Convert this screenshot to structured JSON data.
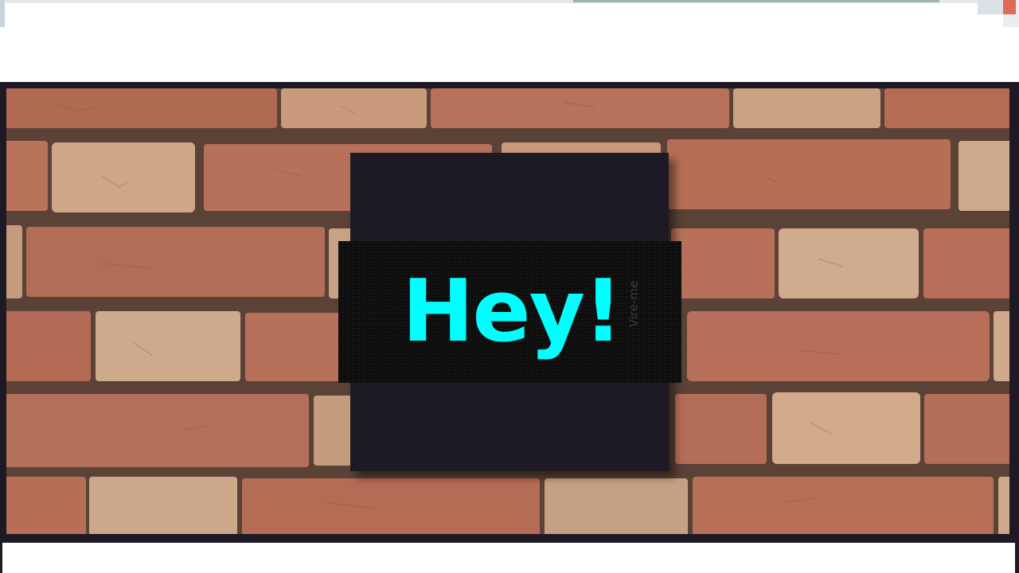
{
  "hero": {
    "heading": "Hey!",
    "vertical_label": "Vire-me"
  },
  "colors": {
    "heading": "#00ffff",
    "card": "#1d1a26",
    "band": "#0d0d0d",
    "page": "#ffffff"
  },
  "icons": {
    "background": "brick-wall-image"
  }
}
